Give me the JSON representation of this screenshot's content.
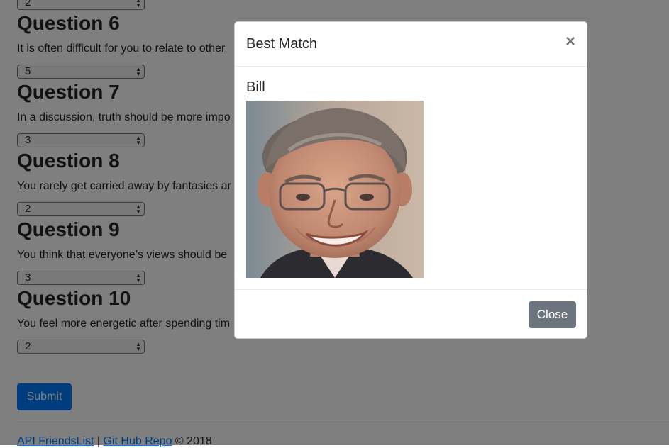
{
  "form": {
    "prev_select_value": "2",
    "questions": [
      {
        "title": "Question 6",
        "text": "It is often difficult for you to relate to other",
        "value": "5"
      },
      {
        "title": "Question 7",
        "text": "In a discussion, truth should be more impo",
        "value": "3"
      },
      {
        "title": "Question 8",
        "text": "You rarely get carried away by fantasies ar",
        "value": "2"
      },
      {
        "title": "Question 9",
        "text": "You think that everyone’s views should be",
        "value": "3"
      },
      {
        "title": "Question 10",
        "text": "You feel more energetic after spending tim",
        "value": "2"
      }
    ],
    "submit_label": "Submit"
  },
  "footer": {
    "link_api": "API FriendsList",
    "separator": " | ",
    "link_repo": "Git Hub Repo",
    "copyright": " © 2018"
  },
  "modal": {
    "title": "Best Match",
    "close_symbol": "×",
    "match_name": "Bill",
    "photo_alt": "Bill",
    "close_label": "Close"
  },
  "icons": {
    "select_arrows": "▲▼",
    "close": "close-icon"
  },
  "colors": {
    "primary": "#007bff",
    "secondary": "#6c757d",
    "backdrop": "rgba(0,0,0,0.5)"
  }
}
